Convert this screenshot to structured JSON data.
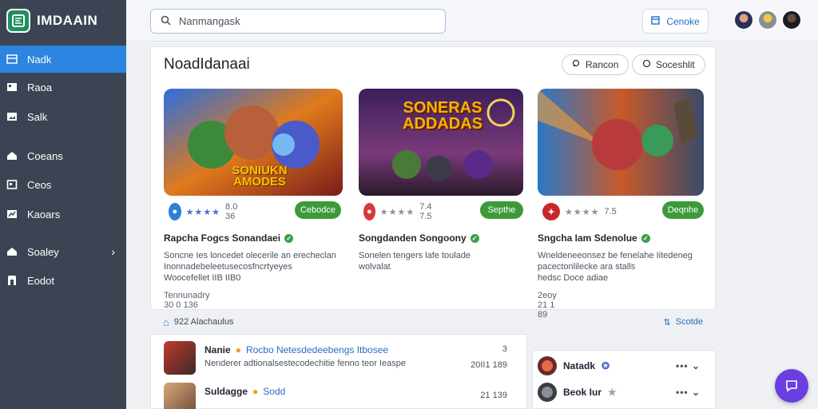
{
  "brand": {
    "name": "IMDAAIN"
  },
  "sidebar": {
    "items": [
      {
        "label": "Nadk",
        "icon": "list-icon",
        "active": true
      },
      {
        "label": "Raoa",
        "icon": "grid-icon"
      },
      {
        "label": "Salk",
        "icon": "image-icon"
      },
      {
        "label": "Coeans",
        "icon": "home-icon"
      },
      {
        "label": "Ceos",
        "icon": "box-icon"
      },
      {
        "label": "Kaoars",
        "icon": "chart-icon"
      },
      {
        "label": "Soaley",
        "icon": "house-icon",
        "has_chevron": true
      },
      {
        "label": "Eodot",
        "icon": "bookmark-icon"
      }
    ]
  },
  "topbar": {
    "search_value": "Nanmangask",
    "button_label": "Cenoke"
  },
  "panel": {
    "title": "NoadIdanaai",
    "pills": [
      {
        "label": "Rancon",
        "icon": "search-icon"
      },
      {
        "label": "Soceshlit",
        "icon": "circle-icon"
      }
    ],
    "cards": [
      {
        "thumb_text": "SONIUKN AMODES",
        "stars": "★★★★",
        "rating": "8.0 36",
        "button": "Cebodce",
        "title": "Rapcha Fogcs Sonandaei",
        "desc_lines": [
          "Soncne Ies loncedet olecerile an erecheclan",
          "Inonnadebeleetusecosfncrtyeyes",
          "Woocefellet IIB IIB0"
        ],
        "date": "Tennunadry 30 0 136",
        "icon_color": "#2f7fd8"
      },
      {
        "thumb_text": "SONERAS ADDADAS",
        "stars": "★★★★",
        "rating": "7.4 7.5",
        "button": "Septhe",
        "title": "Songdanden Songoony",
        "desc_lines": [
          "Sonelen tengers lafe toulade",
          "wolvalat"
        ],
        "date": "",
        "icon_color": "#d83a3a"
      },
      {
        "thumb_text": "",
        "stars": "★★★★",
        "rating": "7.5",
        "button": "Deqnhe",
        "title": "Sngcha Iam Sdenolue",
        "desc_lines": [
          "Wneldeneeonsez be fenelahe Iitedeneg",
          "pacectonlilecke ara stalls",
          "hedsc Doce adiae"
        ],
        "date": "2eoy 21 1 89",
        "icon_color": "#c8262b"
      }
    ]
  },
  "strip": {
    "left_text": "922 Alachaulus",
    "right_text": "Scotde"
  },
  "feed": [
    {
      "name": "Nanie",
      "tag": "Rocbo  Netesdedeebengs Itbosee",
      "text": "Nenderer adtionalsestecodechitie fenno teor Ieaspe",
      "time": "3",
      "time2": "20II1 189",
      "color": "#8a3a2a"
    },
    {
      "name": "Suldagge",
      "tag": "Sodd",
      "text": "",
      "time": "",
      "time2": "21 139",
      "color": "#b8865a"
    }
  ],
  "right_list": [
    {
      "name": "Natadk",
      "color": "#a4463a"
    },
    {
      "name": "Beok Iur",
      "color": "#50545c"
    }
  ],
  "colors": {
    "sidebar": "#3c4453",
    "accent": "#2b84e0",
    "play": "#3c9a3a",
    "fab": "#6a3ee0"
  }
}
